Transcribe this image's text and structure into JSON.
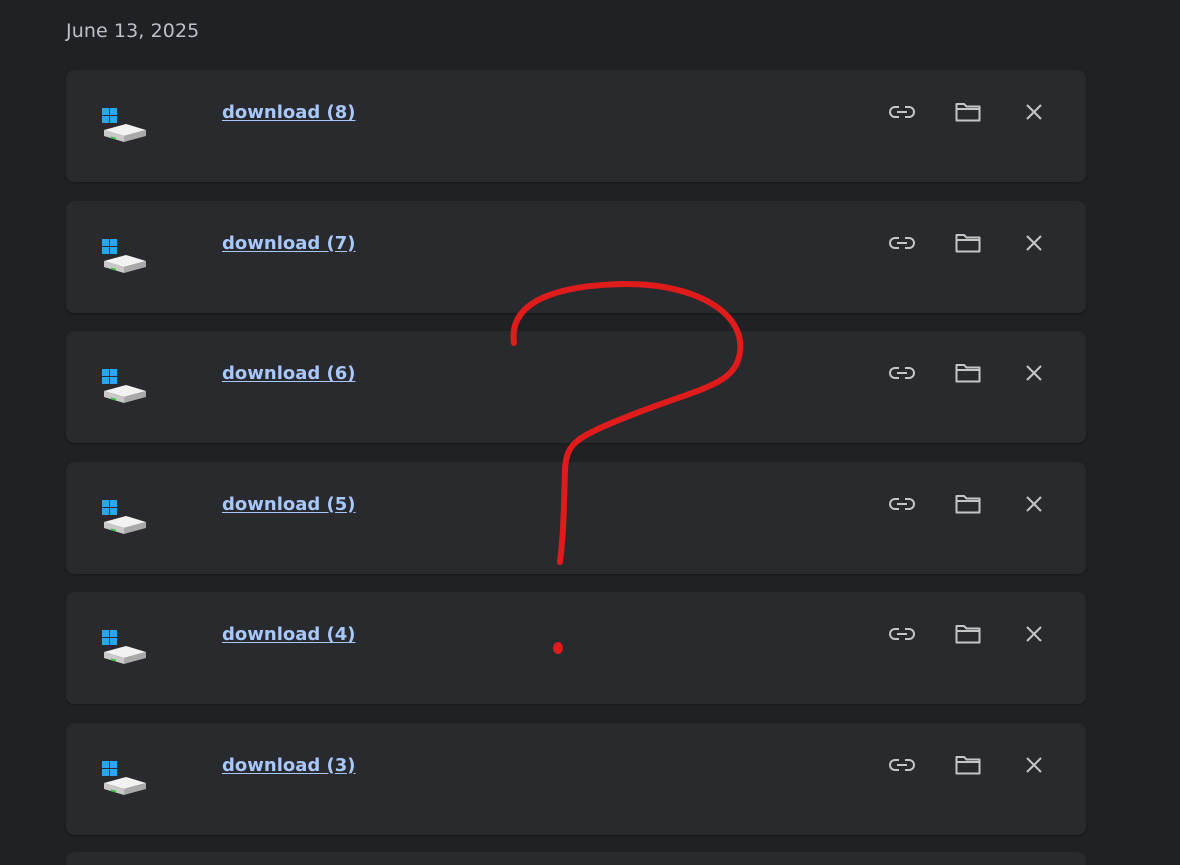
{
  "date_heading": "June 13, 2025",
  "downloads": [
    {
      "name": "download (8)"
    },
    {
      "name": "download (7)"
    },
    {
      "name": "download (6)"
    },
    {
      "name": "download (5)"
    },
    {
      "name": "download (4)"
    },
    {
      "name": "download (3)"
    }
  ],
  "icons": {
    "file": "drive-installer-icon",
    "copy_link": "link-icon",
    "show_in_folder": "folder-icon",
    "remove": "close-icon"
  },
  "colors": {
    "background": "#202124",
    "card": "#292a2d",
    "link": "#a8c7fa",
    "icon": "#c4c7c5",
    "annotation": "#e01b1b"
  }
}
